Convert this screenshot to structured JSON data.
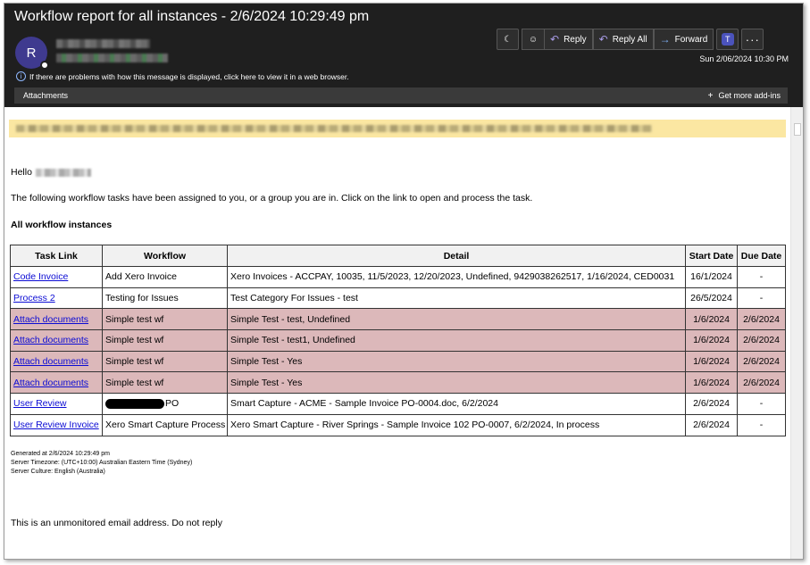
{
  "email": {
    "subject": "Workflow report for all instances - 2/6/2024 10:29:49 pm",
    "sender_initial": "R",
    "date": "Sun 2/06/2024 10:30 PM",
    "info_bar": "If there are problems with how this message is displayed, click here to view it in a web browser.",
    "attachments_label": "Attachments",
    "addins_label": "Get more add-ins"
  },
  "toolbar": {
    "reply_label": "Reply",
    "reply_all_label": "Reply All",
    "forward_label": "Forward",
    "teams_label": "T",
    "more_label": "···"
  },
  "body": {
    "greeting": "Hello",
    "intro": "The following workflow tasks have been assigned to you, or a group you are in. Click on the link to open and process the task.",
    "section_title": "All workflow instances",
    "columns": [
      "Task Link",
      "Workflow",
      "Detail",
      "Start Date",
      "Due Date"
    ],
    "rows": [
      {
        "task": "Code Invoice",
        "workflow": "Add Xero Invoice",
        "detail": "Xero Invoices - ACCPAY, 10035, 11/5/2023, 12/20/2023, Undefined, 9429038262517, 1/16/2024, CED0031",
        "start": "16/1/2024",
        "due": "-",
        "highlight": false
      },
      {
        "task": "Process 2",
        "workflow": "Testing for Issues",
        "detail": "Test Category For Issues - test",
        "start": "26/5/2024",
        "due": "-",
        "highlight": false
      },
      {
        "task": "Attach documents",
        "workflow": "Simple test wf",
        "detail": "Simple Test - test, Undefined",
        "start": "1/6/2024",
        "due": "2/6/2024",
        "highlight": true
      },
      {
        "task": "Attach documents",
        "workflow": "Simple test wf",
        "detail": "Simple Test - test1, Undefined",
        "start": "1/6/2024",
        "due": "2/6/2024",
        "highlight": true
      },
      {
        "task": "Attach documents",
        "workflow": "Simple test wf",
        "detail": "Simple Test - Yes",
        "start": "1/6/2024",
        "due": "2/6/2024",
        "highlight": true
      },
      {
        "task": "Attach documents",
        "workflow": "Simple test wf",
        "detail": "Simple Test - Yes",
        "start": "1/6/2024",
        "due": "2/6/2024",
        "highlight": true
      },
      {
        "task": "User Review",
        "workflow": "PO",
        "workflow_redacted": true,
        "detail": "Smart Capture - ACME - Sample Invoice PO-0004.doc, 6/2/2024",
        "start": "2/6/2024",
        "due": "-",
        "highlight": false
      },
      {
        "task": "User Review Invoice",
        "workflow": "Xero Smart Capture Process",
        "detail": "Xero Smart Capture - River Springs - Sample Invoice 102 PO-0007, 6/2/2024, In process",
        "start": "2/6/2024",
        "due": "-",
        "highlight": false
      }
    ],
    "generated_at": "Generated at 2/6/2024 10:29:49 pm",
    "server_timezone": "Server Timezone: (UTC+10:00) Australian Eastern Time (Sydney)",
    "server_culture": "Server Culture: English (Australia)",
    "closing": "This is an unmonitored email address. Do not reply"
  },
  "colors": {
    "header_bg": "#1f1f1f",
    "highlight_row": "#dcb8ba",
    "banner": "#fbe7a2",
    "link": "#0b0bd4",
    "avatar": "#3f3a8f"
  },
  "icons": {
    "info": "info-icon",
    "moon": "moon-icon",
    "emoji": "emoji-icon",
    "reply": "reply-arrow-icon",
    "reply_all": "reply-all-arrow-icon",
    "forward": "forward-arrow-icon",
    "teams": "teams-icon",
    "more": "more-icon",
    "plus": "plus-icon"
  }
}
